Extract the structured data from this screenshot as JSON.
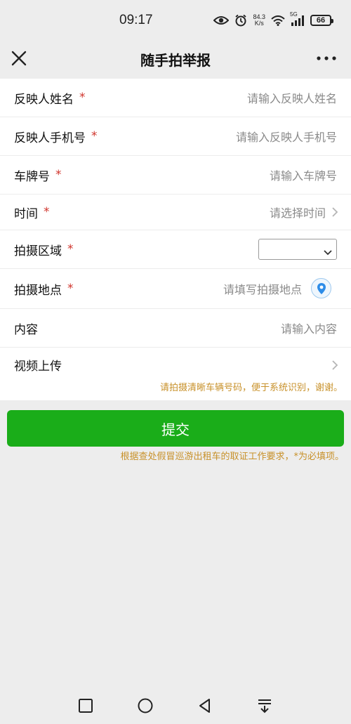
{
  "status_bar": {
    "time": "09:17",
    "net_speed_value": "84.3",
    "net_speed_unit": "K/s",
    "signal_label": "5G",
    "battery": "66",
    "icons": [
      "eye-icon",
      "alarm-icon",
      "wifi-icon",
      "signal-icon",
      "battery-icon"
    ]
  },
  "nav": {
    "title": "随手拍举报",
    "close_icon": "close-icon",
    "more_icon": "more-icon"
  },
  "form": {
    "rows": [
      {
        "label": "反映人姓名",
        "required": "*",
        "placeholder": "请输入反映人姓名"
      },
      {
        "label": "反映人手机号",
        "required": "*",
        "placeholder": "请输入反映人手机号"
      },
      {
        "label": "车牌号",
        "required": "*",
        "placeholder": "请输入车牌号"
      },
      {
        "label": "时间",
        "required": "*",
        "placeholder": "请选择时间"
      },
      {
        "label": "拍摄区域",
        "required": "*",
        "selected": ""
      },
      {
        "label": "拍摄地点",
        "required": "*",
        "placeholder": "请填写拍摄地点"
      },
      {
        "label": "内容",
        "placeholder": "请输入内容"
      },
      {
        "label": "视频上传",
        "hint": "请拍摄清晰车辆号码，便于系统识别，谢谢。"
      }
    ]
  },
  "submit_label": "提交",
  "footer_note": "根据查处假冒巡游出租车的取证工作要求，*为必填项。",
  "colors": {
    "accent": "#1aad19",
    "required": "#d0342c",
    "hint": "#c8912a"
  }
}
